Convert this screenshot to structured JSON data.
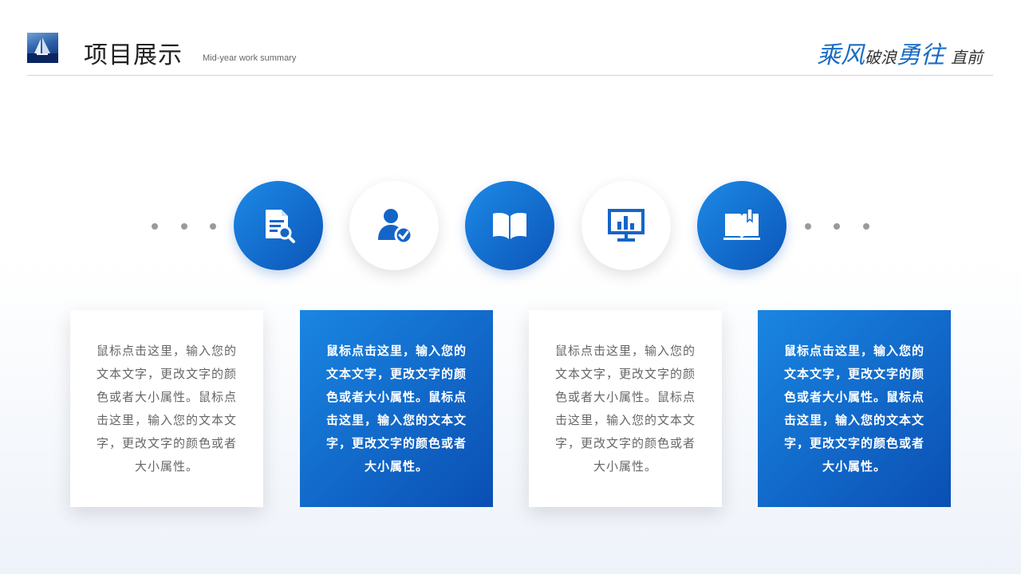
{
  "header": {
    "title": "项目展示",
    "subtitle": "Mid-year work summary",
    "slogan": {
      "part1": "乘风",
      "part2": "破浪",
      "part3": "勇往",
      "part4": "直前"
    }
  },
  "icons": [
    {
      "name": "document-search-icon",
      "style": "blue"
    },
    {
      "name": "user-check-icon",
      "style": "white"
    },
    {
      "name": "open-book-icon",
      "style": "blue"
    },
    {
      "name": "presentation-chart-icon",
      "style": "white"
    },
    {
      "name": "book-bookmark-icon",
      "style": "blue"
    }
  ],
  "cards": [
    {
      "text": "鼠标点击这里，输入您的文本文字，更改文字的颜色或者大小属性。鼠标点击这里，输入您的文本文字，更改文字的颜色或者大小属性。",
      "style": "white"
    },
    {
      "text": "鼠标点击这里，输入您的文本文字，更改文字的颜色或者大小属性。鼠标点击这里，输入您的文本文字，更改文字的颜色或者大小属性。",
      "style": "blue"
    },
    {
      "text": "鼠标点击这里，输入您的文本文字，更改文字的颜色或者大小属性。鼠标点击这里，输入您的文本文字，更改文字的颜色或者大小属性。",
      "style": "white"
    },
    {
      "text": "鼠标点击这里，输入您的文本文字，更改文字的颜色或者大小属性。鼠标点击这里，输入您的文本文字，更改文字的颜色或者大小属性。",
      "style": "blue"
    }
  ],
  "colors": {
    "accent": "#1a6cc4",
    "accent_dark": "#0b55b8",
    "text_gray": "#666666"
  }
}
